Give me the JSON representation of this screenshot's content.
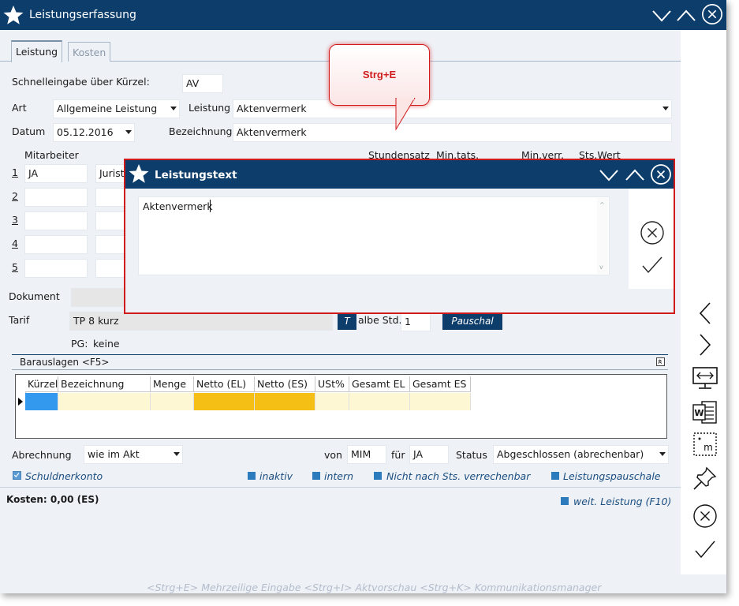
{
  "window": {
    "title": "Leistungserfassung"
  },
  "tabs": [
    {
      "label": "Leistung"
    },
    {
      "label": "Kosten"
    }
  ],
  "form": {
    "schnell_label": "Schnelleingabe über Kürzel:",
    "schnell_value": "AV",
    "art_label": "Art",
    "art_value": "Allgemeine Leistung",
    "leistung_label": "Leistung",
    "leistung_value": "Aktenvermerk",
    "datum_label": "Datum",
    "datum_value": "05.12.2016",
    "bezeichnung_label": "Bezeichnung",
    "bezeichnung_value": "Aktenvermerk",
    "mitarbeiter_label": "Mitarbeiter",
    "col_stundensatz": "Stundensatz",
    "col_mintats": "Min.tats.",
    "col_minverr": "Min.verr.",
    "col_stswert": "Sts.Wert",
    "rows": [
      {
        "num": "1",
        "kuerzel": "JA",
        "rolle": "Jurist"
      },
      {
        "num": "2",
        "kuerzel": "",
        "rolle": ""
      },
      {
        "num": "3",
        "kuerzel": "",
        "rolle": ""
      },
      {
        "num": "4",
        "kuerzel": "",
        "rolle": ""
      },
      {
        "num": "5",
        "kuerzel": "",
        "rolle": ""
      }
    ],
    "dokument_label": "Dokument",
    "tarif_label": "Tarif",
    "tarif_value": "TP 8 kurz",
    "t_button": "T",
    "halbe_label": "albe Std.",
    "halbe_value": "1",
    "pauschal_button": "Pauschal",
    "pg_label": "PG:",
    "pg_value": "keine"
  },
  "callout": {
    "text": "Strg+E"
  },
  "dialog": {
    "title": "Leistungstext",
    "text": "Aktenvermerk"
  },
  "barauslagen": {
    "title": "Barauslagen <F5>",
    "columns": [
      "Kürzel",
      "Bezeichnung",
      "Menge",
      "Netto (EL)",
      "Netto (ES)",
      "USt%",
      "Gesamt EL",
      "Gesamt ES"
    ]
  },
  "bottom": {
    "abrechnung_label": "Abrechnung",
    "abrechnung_value": "wie im Akt",
    "von_label": "von",
    "von_value": "MIM",
    "fuer_label": "für",
    "fuer_value": "JA",
    "status_label": "Status",
    "status_value": "Abgeschlossen (abrechenbar)",
    "schuldnerkonto": "Schuldnerkonto",
    "inaktiv": "inaktiv",
    "intern": "intern",
    "nicht_nach": "Nicht nach Sts. verrechenbar",
    "pauschale": "Leistungspauschale",
    "kosten": "Kosten: 0,00 (ES)",
    "weit": "weit. Leistung (F10)"
  },
  "footer": {
    "text": "<Strg+E> Mehrzeilige Eingabe <Strg+I> Aktvorschau <Strg+K> Kommunikationsmanager"
  },
  "colors": {
    "navy": "#0d3d6b",
    "accent_red": "#d11b1b",
    "cell_yellow": "#fdf7d4",
    "cell_orange": "#f6bf16",
    "cell_blue": "#3399ee",
    "check_blue": "#2b7bbd"
  }
}
